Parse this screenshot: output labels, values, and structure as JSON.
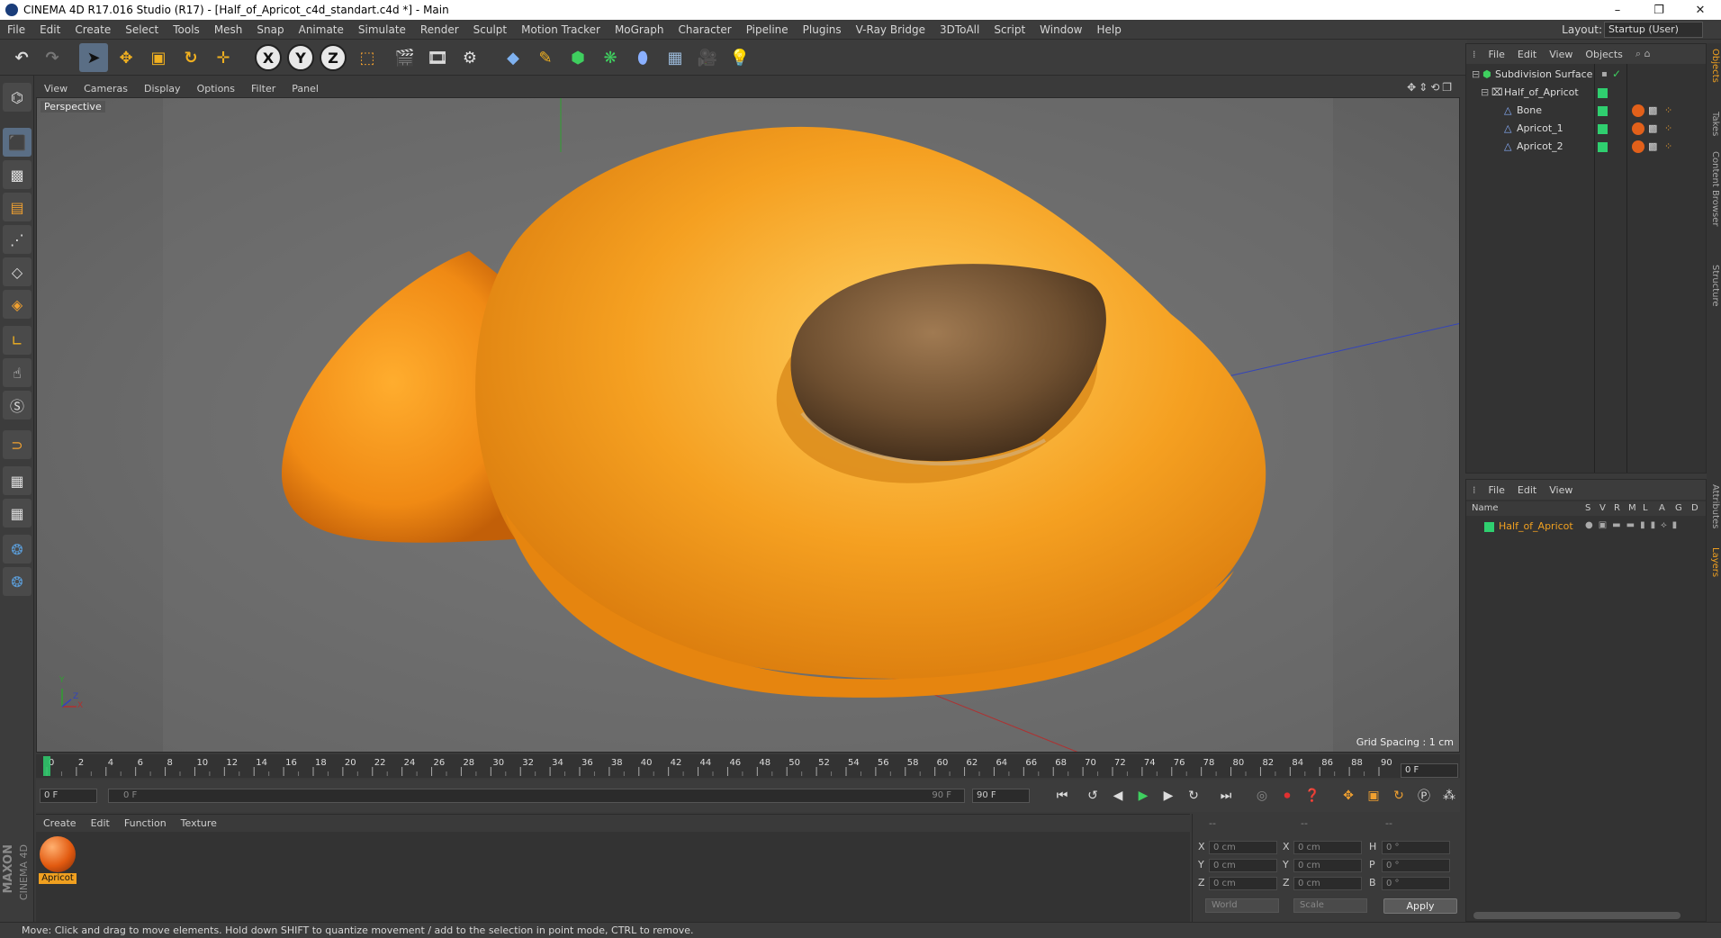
{
  "window": {
    "title": "CINEMA 4D R17.016 Studio (R17) - [Half_of_Apricot_c4d_standart.c4d *] - Main",
    "controls": [
      "–",
      "❐",
      "✕"
    ]
  },
  "menu": [
    "File",
    "Edit",
    "Create",
    "Select",
    "Tools",
    "Mesh",
    "Snap",
    "Animate",
    "Simulate",
    "Render",
    "Sculpt",
    "Motion Tracker",
    "MoGraph",
    "Character",
    "Pipeline",
    "Plugins",
    "V-Ray Bridge",
    "3DToAll",
    "Script",
    "Window",
    "Help"
  ],
  "layout": {
    "label": "Layout:",
    "value": "Startup (User)"
  },
  "toolbar": {
    "axis_x": "X",
    "axis_y": "Y",
    "axis_z": "Z"
  },
  "viewport": {
    "menu": [
      "View",
      "Cameras",
      "Display",
      "Options",
      "Filter",
      "Panel"
    ],
    "label": "Perspective",
    "grid_spacing": "Grid Spacing : 1 cm",
    "axis_y": "Y",
    "axis_x": "X",
    "axis_z": "Z"
  },
  "timeline": {
    "ticks": [
      "0",
      "2",
      "4",
      "6",
      "8",
      "10",
      "12",
      "14",
      "16",
      "18",
      "20",
      "22",
      "24",
      "26",
      "28",
      "30",
      "32",
      "34",
      "36",
      "38",
      "40",
      "42",
      "44",
      "46",
      "48",
      "50",
      "52",
      "54",
      "56",
      "58",
      "60",
      "62",
      "64",
      "66",
      "68",
      "70",
      "72",
      "74",
      "76",
      "78",
      "80",
      "82",
      "84",
      "86",
      "88",
      "90"
    ],
    "frame": "0 F",
    "start": "0 F",
    "range_start": "0 F",
    "range_end": "90 F",
    "end": "90 F"
  },
  "materials": {
    "menu": [
      "Create",
      "Edit",
      "Function",
      "Texture"
    ],
    "items": [
      {
        "name": "Apricot"
      }
    ]
  },
  "coords": {
    "header": [
      "--",
      "--",
      "--"
    ],
    "rows": [
      {
        "l1": "X",
        "v1": "0 cm",
        "l2": "X",
        "v2": "0 cm",
        "l3": "H",
        "v3": "0 °"
      },
      {
        "l1": "Y",
        "v1": "0 cm",
        "l2": "Y",
        "v2": "0 cm",
        "l3": "P",
        "v3": "0 °"
      },
      {
        "l1": "Z",
        "v1": "0 cm",
        "l2": "Z",
        "v2": "0 cm",
        "l3": "B",
        "v3": "0 °"
      }
    ],
    "mode1": "World",
    "mode2": "Scale",
    "apply": "Apply"
  },
  "object_manager": {
    "menu": [
      "File",
      "Edit",
      "View",
      "Objects"
    ],
    "objects": [
      {
        "name": "Subdivision Surface"
      },
      {
        "name": "Half_of_Apricot"
      },
      {
        "name": "Bone"
      },
      {
        "name": "Apricot_1"
      },
      {
        "name": "Apricot_2"
      }
    ]
  },
  "layers": {
    "menu": [
      "File",
      "Edit",
      "View"
    ],
    "columns": [
      "Name",
      "S",
      "V",
      "R",
      "M",
      "L",
      "A",
      "G",
      "D"
    ],
    "items": [
      {
        "name": "Half_of_Apricot"
      }
    ]
  },
  "side_tabs": [
    "Objects",
    "Takes",
    "Content Browser",
    "Structure",
    "Attributes",
    "Layers"
  ],
  "brand": {
    "line1": "MAXON",
    "line2": "CINEMA 4D"
  },
  "status": "Move: Click and drag to move elements. Hold down SHIFT to quantize movement / add to the selection in point mode, CTRL to remove.",
  "colors": {
    "accent": "#5a6e85",
    "layer_green": "#2fcf6f",
    "material_label": "#f0a020",
    "apricot": "#f29a1a"
  }
}
